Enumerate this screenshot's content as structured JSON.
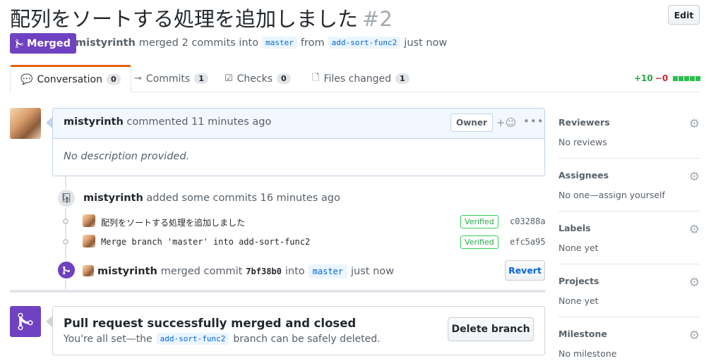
{
  "header": {
    "title": "配列をソートする処理を追加しました",
    "number": "#2",
    "edit_label": "Edit",
    "state_label": "Merged",
    "author": "mistyrinth",
    "merged_text": "merged 2 commits into",
    "base_branch": "master",
    "from_text": "from",
    "head_branch": "add-sort-func2",
    "time_text": "just now"
  },
  "tabs": [
    {
      "label": "Conversation",
      "count": "0"
    },
    {
      "label": "Commits",
      "count": "1"
    },
    {
      "label": "Checks",
      "count": "0"
    },
    {
      "label": "Files changed",
      "count": "1"
    }
  ],
  "diffstat": {
    "additions": "+10",
    "deletions": "−0",
    "blocks": 5
  },
  "comment": {
    "author": "mistyrinth",
    "action": "commented 11 minutes ago",
    "role": "Owner",
    "body": "No description provided."
  },
  "timeline": {
    "commits_event": {
      "author": "mistyrinth",
      "text": "added some commits 16 minutes ago"
    },
    "commits": [
      {
        "message": "配列をソートする処理を追加しました",
        "verified": "Verified",
        "sha": "c03288a"
      },
      {
        "message": "Merge branch 'master' into add-sort-func2",
        "verified": "Verified",
        "sha": "efc5a95"
      }
    ],
    "merge_event": {
      "author": "mistyrinth",
      "text": "merged commit",
      "commit": "7bf38b0",
      "into_text": "into",
      "branch": "master",
      "time": "just now",
      "revert_label": "Revert"
    }
  },
  "merged_box": {
    "title": "Pull request successfully merged and closed",
    "desc_before": "You're all set—the",
    "branch": "add-sort-func2",
    "desc_after": "branch can be safely deleted.",
    "delete_label": "Delete branch"
  },
  "sidebar": [
    {
      "title": "Reviewers",
      "value": "No reviews"
    },
    {
      "title": "Assignees",
      "value": "No one—assign yourself"
    },
    {
      "title": "Labels",
      "value": "None yet"
    },
    {
      "title": "Projects",
      "value": "None yet"
    },
    {
      "title": "Milestone",
      "value": "No milestone"
    }
  ],
  "colors": {
    "merged": "#6f42c1",
    "link": "#0366d6",
    "add": "#28a745",
    "del": "#cb2431"
  }
}
